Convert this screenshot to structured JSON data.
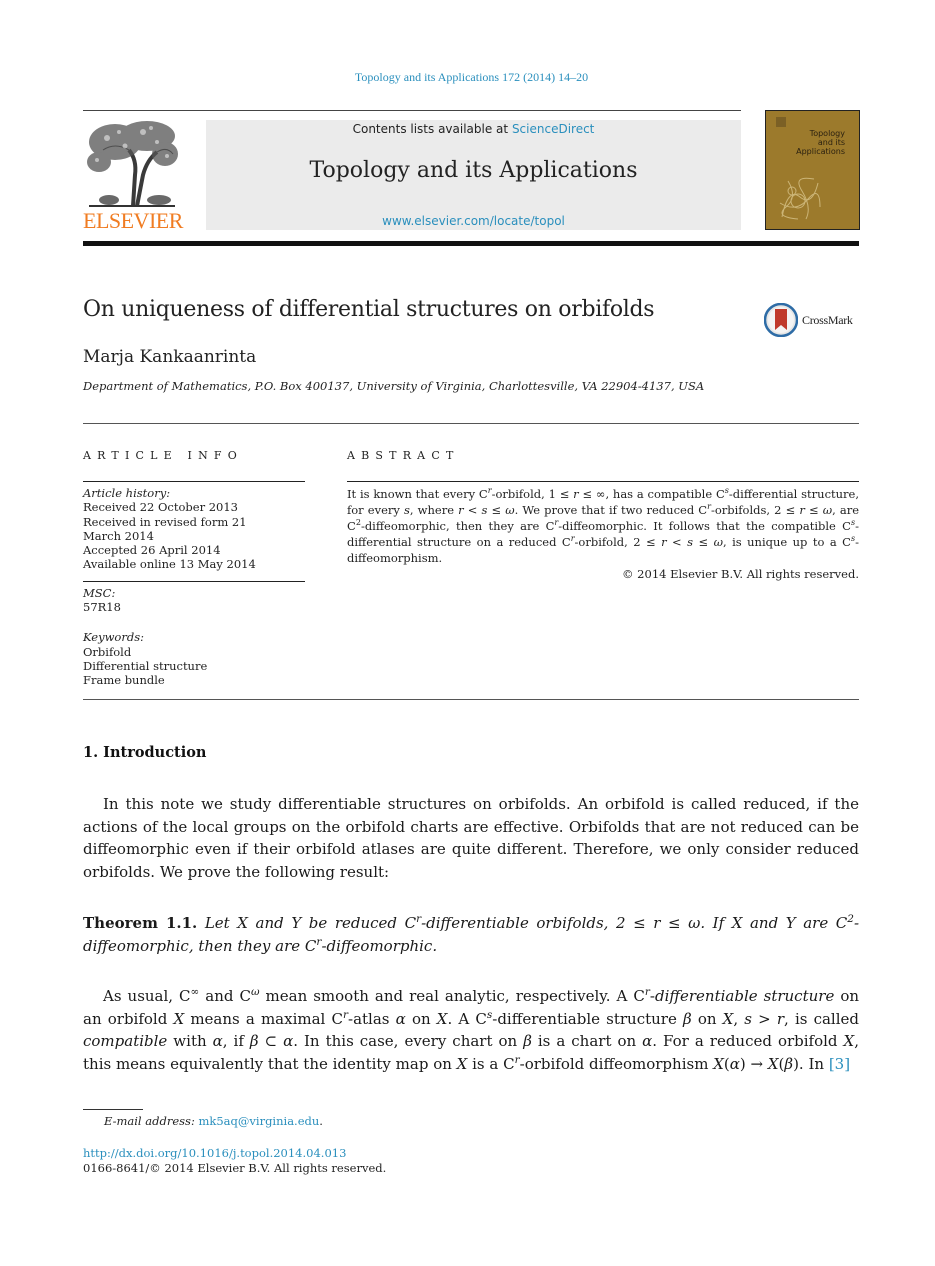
{
  "journal_citation": "Topology and its Applications 172 (2014) 14–20",
  "header": {
    "publisher_logo_text": "ELSEVIER",
    "contents_prefix": "Contents lists available at ",
    "contents_link": "ScienceDirect",
    "journal_title": "Topology and its Applications",
    "journal_url": "www.elsevier.com/locate/topol",
    "cover_title_lines": [
      "Topology",
      "and its",
      "Applications"
    ]
  },
  "colors": {
    "link": "#2a8fbd",
    "elsevier_orange": "#f07c22",
    "header_box_bg": "#ebebeb",
    "cover_bg": "#9c7a2c"
  },
  "article": {
    "title": "On uniqueness of differential structures on orbifolds",
    "crossmark_label": "CrossMark",
    "author": "Marja Kankaanrinta",
    "affiliation": "Department of Mathematics, P.O. Box 400137, University of Virginia, Charlottesville, VA 22904-4137, USA"
  },
  "article_info": {
    "heading": "ARTICLE INFO",
    "history_label": "Article history:",
    "history": [
      "Received 22 October 2013",
      "Received in revised form 21 March 2014",
      "Accepted 26 April 2014",
      "Available online 13 May 2014"
    ],
    "msc_label": "MSC:",
    "msc": "57R18",
    "keywords_label": "Keywords:",
    "keywords": [
      "Orbifold",
      "Differential structure",
      "Frame bundle"
    ]
  },
  "abstract": {
    "heading": "ABSTRACT",
    "text_html": "It is known that every C<sup><i>r</i></sup>-orbifold, 1 ≤ <i>r</i> ≤ ∞, has a compatible C<sup><i>s</i></sup>-differential structure, for every <i>s</i>, where <i>r</i> &lt; <i>s</i> ≤ <i>ω</i>. We prove that if two reduced C<sup><i>r</i></sup>-orbifolds, 2 ≤ <i>r</i> ≤ <i>ω</i>, are C<sup>2</sup>-diffeomorphic, then they are C<sup><i>r</i></sup>-diffeomorphic. It follows that the compatible C<sup><i>s</i></sup>-differential structure on a reduced C<sup><i>r</i></sup>-orbifold, 2 ≤ <i>r</i> &lt; <i>s</i> ≤ <i>ω</i>, is unique up to a C<sup><i>s</i></sup>-diffeomorphism.",
    "copyright": "© 2014 Elsevier B.V. All rights reserved."
  },
  "body": {
    "section_heading": "1.  Introduction",
    "intro_paragraph": "In this note we study differentiable structures on orbifolds. An orbifold is called reduced, if the actions of the local groups on the orbifold charts are effective. Orbifolds that are not reduced can be diffeomorphic even if their orbifold atlases are quite different. Therefore, we only consider reduced orbifolds. We prove the following result:",
    "theorem_label": "Theorem 1.1.",
    "theorem_html": "Let <i>X</i> and <i>Y</i> be reduced C<sup><i>r</i></sup>-differentiable orbifolds, 2 ≤ <i>r</i> ≤ <i>ω</i>. If <i>X</i> and <i>Y</i> are C<sup>2</sup>-diffeomorphic, then they are C<sup><i>r</i></sup>-diffeomorphic.",
    "paragraph2_html": "As usual, C<sup>∞</sup> and C<sup><i>ω</i></sup> mean smooth and real analytic, respectively. A C<sup><i>r</i></sup>-<i>differentiable structure</i> on an orbifold <i>X</i> means a maximal C<sup><i>r</i></sup>-atlas <i>α</i> on <i>X</i>. A C<sup><i>s</i></sup>-differentiable structure <i>β</i> on <i>X</i>, <i>s</i> &gt; <i>r</i>, is called <i>compatible</i> with <i>α</i>, if <i>β</i> ⊂ <i>α</i>. In this case, every chart on <i>β</i> is a chart on <i>α</i>. For a reduced orbifold <i>X</i>, this means equivalently that the identity map on <i>X</i> is a C<sup><i>r</i></sup>-orbifold diffeomorphism <i>X</i>(<i>α</i>) → <i>X</i>(<i>β</i>). In ",
    "citation_ref": "[3]"
  },
  "footer": {
    "email_label": "E-mail address: ",
    "email": "mk5aq@virginia.edu",
    "doi_url": "http://dx.doi.org/10.1016/j.topol.2014.04.013",
    "issn_copyright": "0166-8641/© 2014 Elsevier B.V. All rights reserved."
  }
}
